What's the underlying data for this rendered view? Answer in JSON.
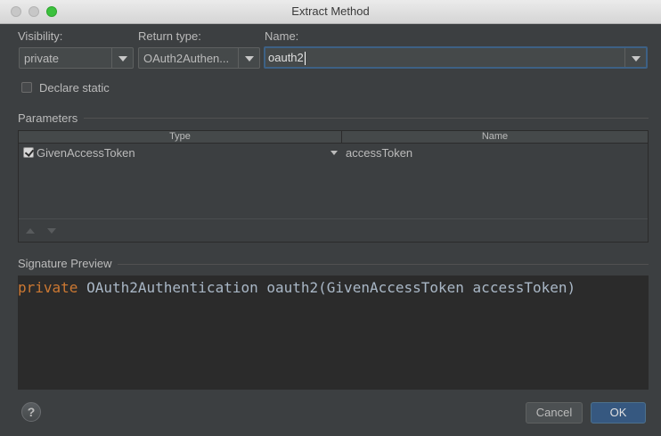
{
  "window": {
    "title": "Extract Method"
  },
  "visibility": {
    "label": "Visibility:",
    "value": "private"
  },
  "return_type": {
    "label": "Return type:",
    "value": "OAuth2Authen..."
  },
  "name": {
    "label": "Name:",
    "value": "oauth2"
  },
  "declare_static": {
    "label": "Declare static",
    "checked": false
  },
  "parameters": {
    "title": "Parameters",
    "columns": [
      "Type",
      "Name"
    ],
    "rows": [
      {
        "checked": true,
        "type": "GivenAccessToken",
        "name": "accessToken"
      }
    ]
  },
  "signature_preview": {
    "title": "Signature Preview",
    "keyword": "private",
    "rest": " OAuth2Authentication oauth2(GivenAccessToken accessToken)"
  },
  "buttons": {
    "help": "?",
    "cancel": "Cancel",
    "ok": "OK"
  },
  "colors": {
    "keyword": "#cc7832",
    "code": "#a9b7c6",
    "primary_button": "#365880"
  }
}
